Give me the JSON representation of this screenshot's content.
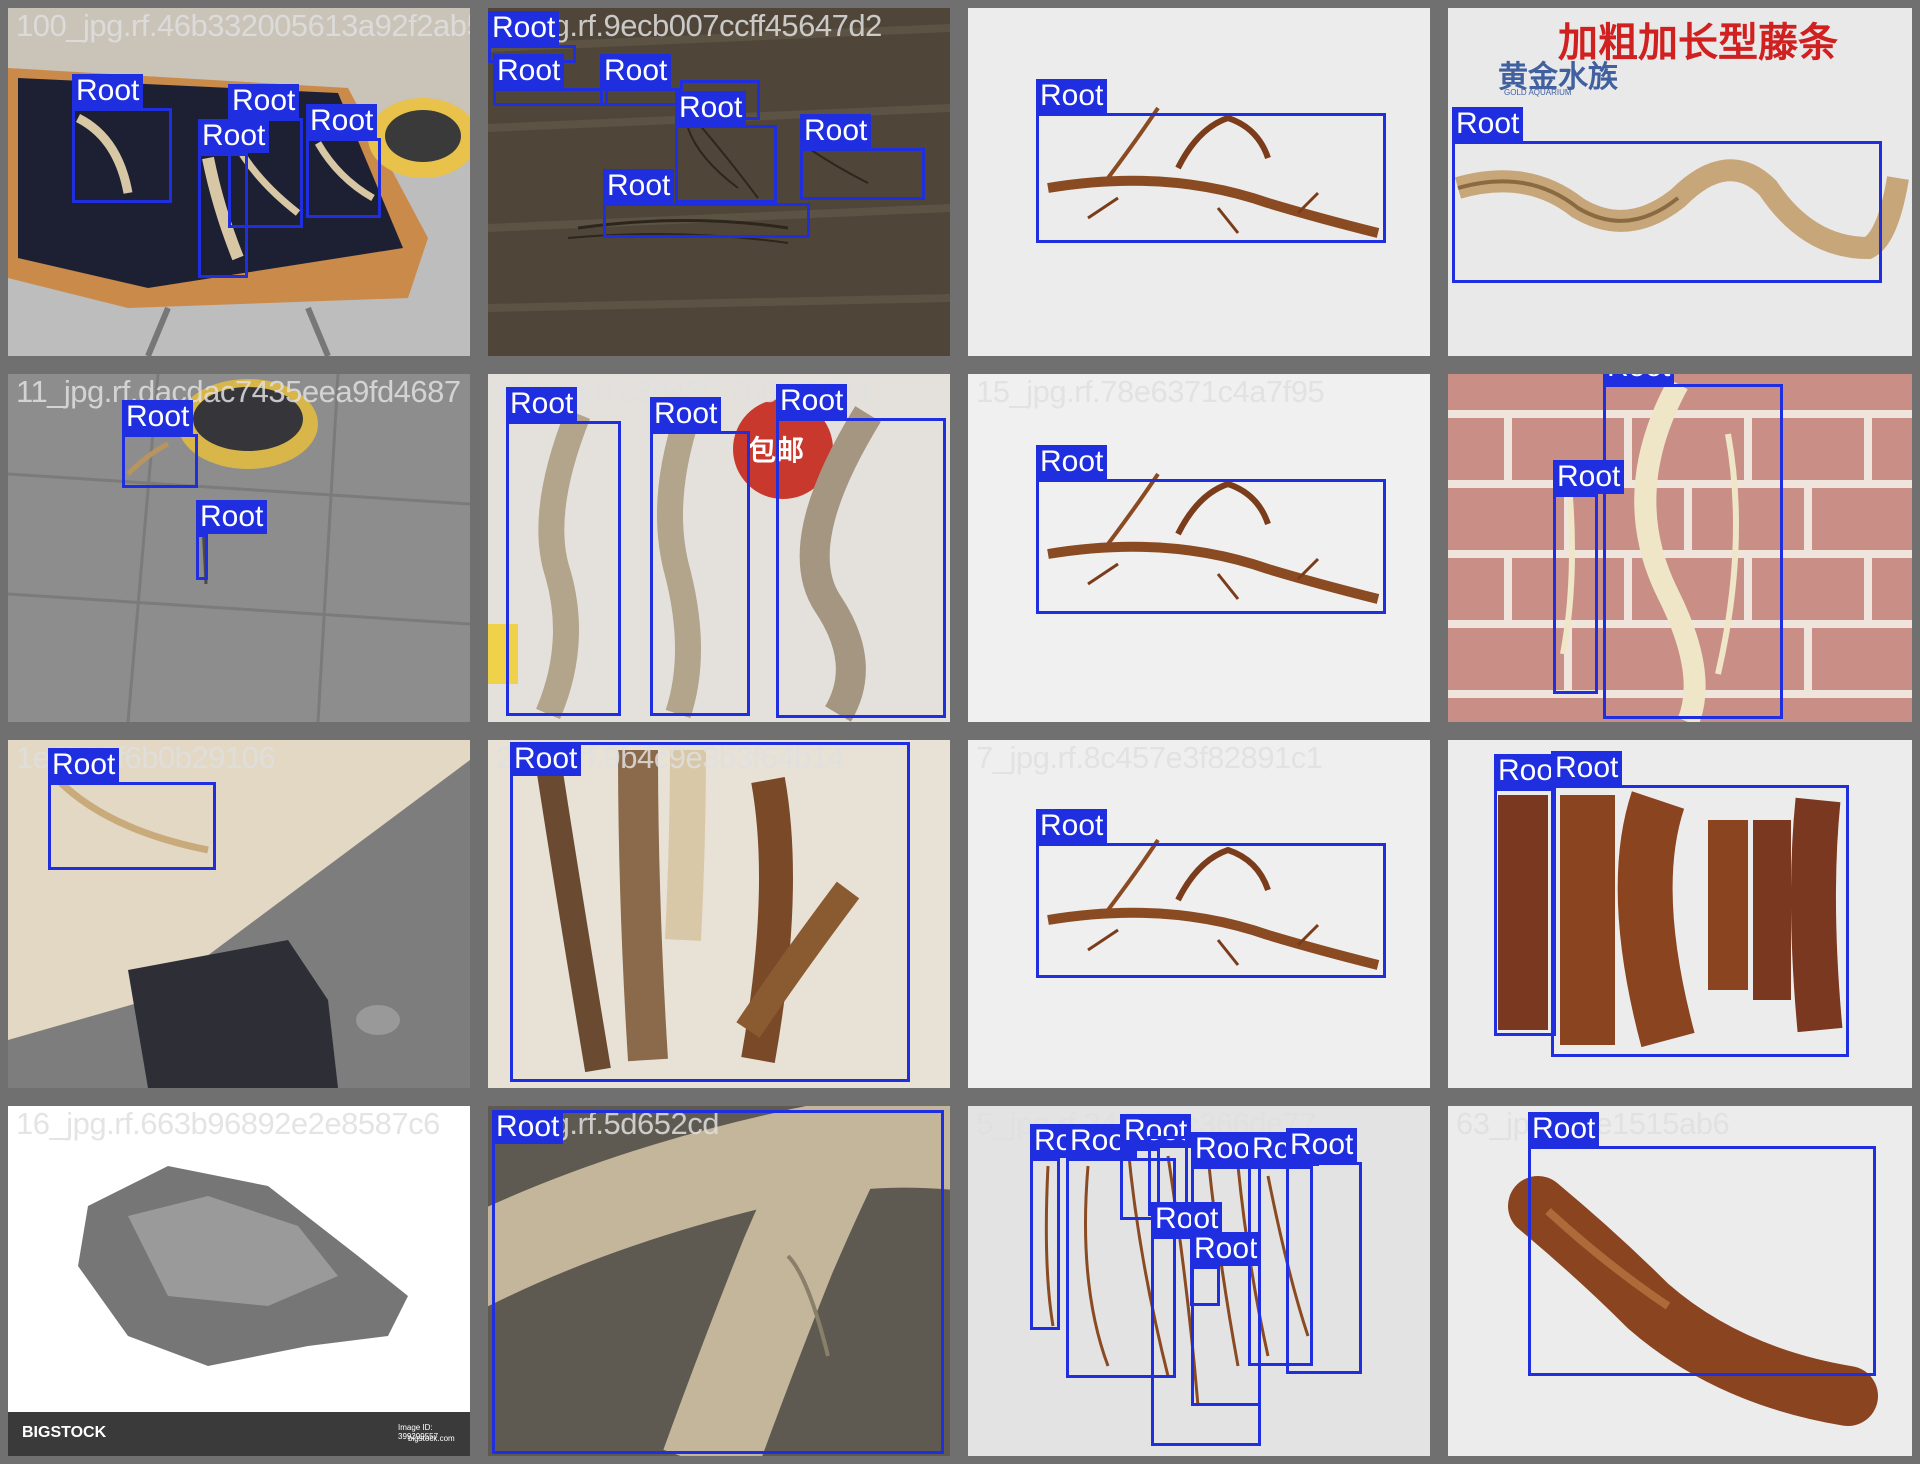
{
  "tiles": [
    {
      "filename": "100_jpg.rf.46b332005613a92f2ab5f385",
      "label": "Root"
    },
    {
      "filename": "1_jpg.rf.9ecb007ccff45647d2",
      "label": "Root"
    },
    {
      "filename": "",
      "label": "Root"
    },
    {
      "filename": "",
      "label": "Root",
      "watermark_cn": "加粗加长型藤条",
      "brand_cn": "黄金水族",
      "brand_en": "GOLD AQUARIUM"
    },
    {
      "filename": "11_jpg.rf.dacdac7435eea9fd4687",
      "label": "Root"
    },
    {
      "filename": "12_jpg.rf.c3d43f1766bf3194",
      "label": "Root",
      "badge": "包邮"
    },
    {
      "filename": "15_jpg.rf.78e6371c4a7f95",
      "label": "Root"
    },
    {
      "filename": "",
      "label": "Root"
    },
    {
      "filename": "1e4526f6b0b29106",
      "label": "Root"
    },
    {
      "filename": "2_jpg.rf.9b4c9e3b3f64b14",
      "label": "Root"
    },
    {
      "filename": "7_jpg.rf.8c457e3f82891c1",
      "label": "Root"
    },
    {
      "filename": "",
      "label": "Root"
    },
    {
      "filename": "16_jpg.rf.663b96892e2e8587c6",
      "label": "Root",
      "stock_brand": "BIGSTOCK",
      "stock_id": "Image ID: 399299557",
      "stock_site": "bigstock.com"
    },
    {
      "filename": "1_jpg.rf.5d652cd",
      "label": "Root"
    },
    {
      "filename": "5_jpg.rf.244360c366de77",
      "label": "Root"
    },
    {
      "filename": "63_jpg.rf.ce1515ab6",
      "label": "Root"
    }
  ],
  "colors": {
    "box": "#1f2fe0",
    "label_text": "#ffffff",
    "grid_bg": "#707070"
  }
}
